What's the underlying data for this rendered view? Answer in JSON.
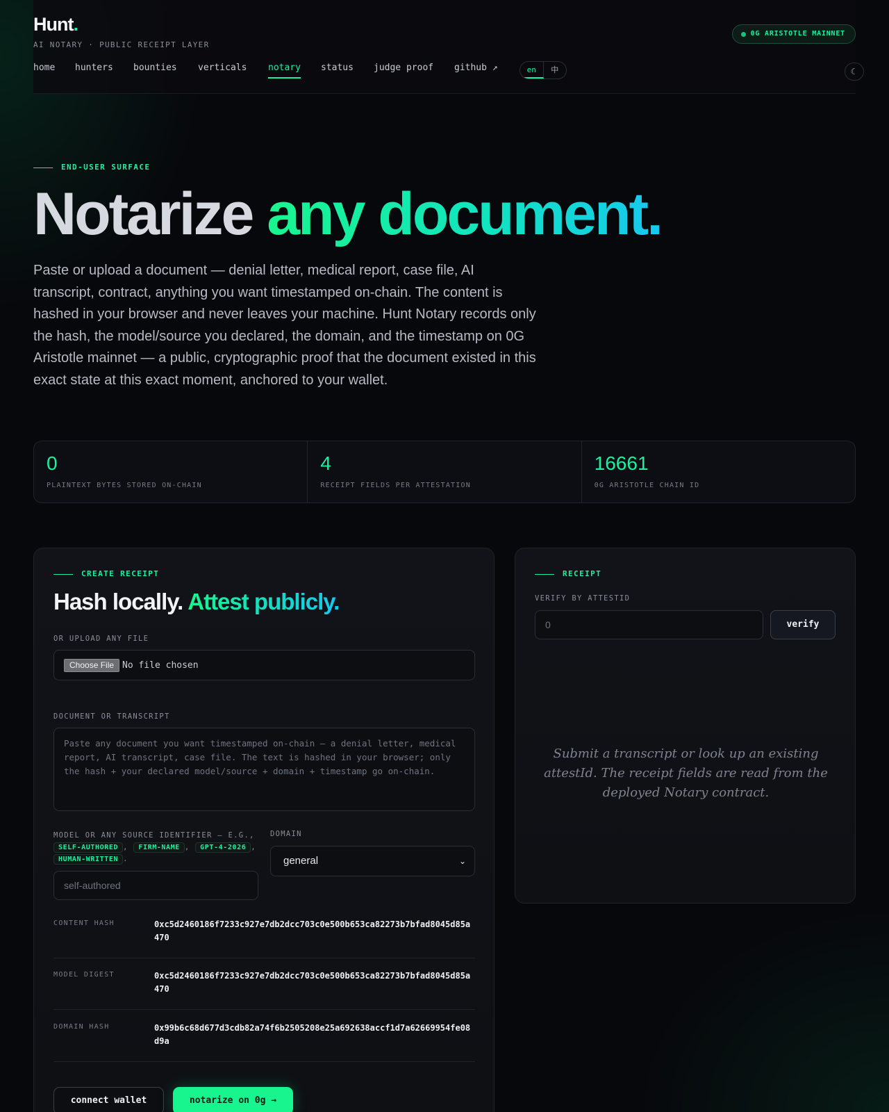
{
  "brand": {
    "logo_text": "Hunt",
    "logo_dot": ".",
    "tagline": "AI NOTARY · PUBLIC RECEIPT LAYER"
  },
  "network_badge": "0G ARISTOTLE MAINNET",
  "nav": {
    "items": [
      {
        "label": "home"
      },
      {
        "label": "hunters"
      },
      {
        "label": "bounties"
      },
      {
        "label": "verticals"
      },
      {
        "label": "notary",
        "active": true
      },
      {
        "label": "status"
      },
      {
        "label": "judge proof"
      },
      {
        "label": "github ↗"
      }
    ],
    "lang": [
      "en",
      "中"
    ],
    "theme_icon": "moon-icon"
  },
  "hero": {
    "eyebrow": "END-USER SURFACE",
    "title_a": "Notarize ",
    "title_b": "any document.",
    "description": "Paste or upload a document — denial letter, medical report, case file, AI transcript, contract, anything you want timestamped on-chain. The content is hashed in your browser and never leaves your machine. Hunt Notary records only the hash, the model/source you declared, the domain, and the timestamp on 0G Aristotle mainnet — a public, cryptographic proof that the document existed in this exact state at this exact moment, anchored to your wallet."
  },
  "stats": [
    {
      "value": "0",
      "label": "PLAINTEXT BYTES STORED ON-CHAIN"
    },
    {
      "value": "4",
      "label": "RECEIPT FIELDS PER ATTESTATION"
    },
    {
      "value": "16661",
      "label": "0G ARISTOTLE CHAIN ID"
    }
  ],
  "create": {
    "eyebrow": "CREATE RECEIPT",
    "title_a": "Hash locally. ",
    "title_b": "Attest publicly.",
    "upload_label": "OR UPLOAD ANY FILE",
    "choose_file": "Choose File",
    "file_status": "No file chosen",
    "doc_label": "DOCUMENT OR TRANSCRIPT",
    "doc_placeholder": "Paste any document you want timestamped on-chain — a denial letter, medical report, AI transcript, case file. The text is hashed in your browser; only the hash + your declared model/source + domain + timestamp go on-chain.",
    "model_label_prefix": "MODEL OR ANY SOURCE IDENTIFIER — E.G., ",
    "model_chips": [
      "SELF-AUTHORED",
      "FIRM-NAME",
      "GPT-4-2026",
      "HUMAN-WRITTEN"
    ],
    "model_placeholder": "self-authored",
    "domain_label": "DOMAIN",
    "domain_value": "general",
    "hashes": [
      {
        "key": "CONTENT HASH",
        "value": "0xc5d2460186f7233c927e7db2dcc703c0e500b653ca82273b7bfad8045d85a470"
      },
      {
        "key": "MODEL DIGEST",
        "value": "0xc5d2460186f7233c927e7db2dcc703c0e500b653ca82273b7bfad8045d85a470"
      },
      {
        "key": "DOMAIN HASH",
        "value": "0x99b6c68d677d3cdb82a74f6b2505208e25a692638accf1d7a62669954fe08d9a"
      }
    ],
    "connect_wallet": "connect wallet",
    "notarize": "notarize on 0g →"
  },
  "receipt": {
    "eyebrow": "RECEIPT",
    "verify_label": "VERIFY BY ATTESTID",
    "verify_placeholder": "0",
    "verify_button": "verify",
    "empty_note": "Submit a transcript or look up an existing attestId. The receipt fields are read from the deployed Notary contract."
  },
  "colors": {
    "accent": "#19f0a0",
    "accent_cyan": "#16c8f0",
    "background": "#07080b"
  }
}
